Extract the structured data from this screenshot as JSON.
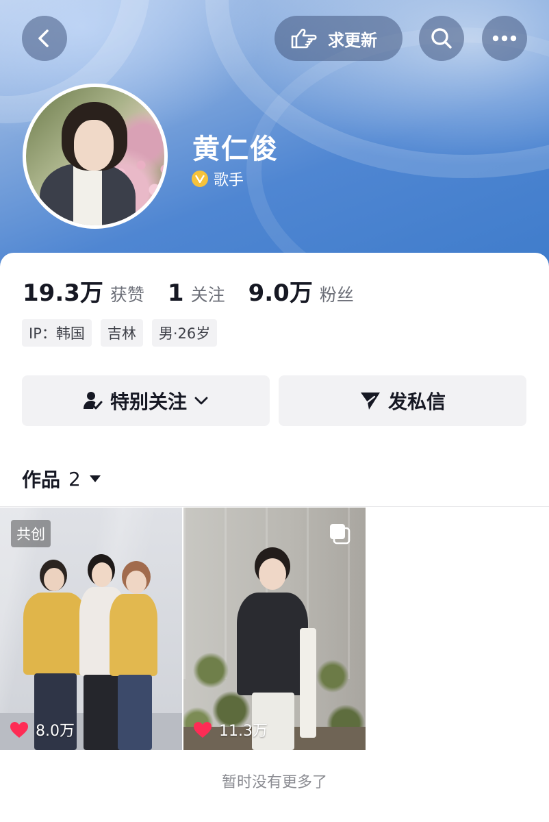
{
  "header": {
    "update_label": "求更新",
    "name": "黄仁俊",
    "verify_label": "歌手"
  },
  "stats": [
    {
      "num": "19.3万",
      "label": "获赞"
    },
    {
      "num": "1",
      "label": "关注"
    },
    {
      "num": "9.0万",
      "label": "粉丝"
    }
  ],
  "tags": [
    "IP：韩国",
    "吉林",
    "男·26岁"
  ],
  "actions": {
    "follow_label": "特别关注",
    "message_label": "发私信"
  },
  "works": {
    "label": "作品",
    "count": "2",
    "items": [
      {
        "badge": "共创",
        "likes": "8.0万"
      },
      {
        "likes": "11.3万"
      }
    ]
  },
  "footer": {
    "empty_text": "暂时没有更多了"
  },
  "colors": {
    "header_blue": "#4f86d2",
    "like_red": "#fe2c55",
    "verify_gold": "#f6c23b"
  }
}
